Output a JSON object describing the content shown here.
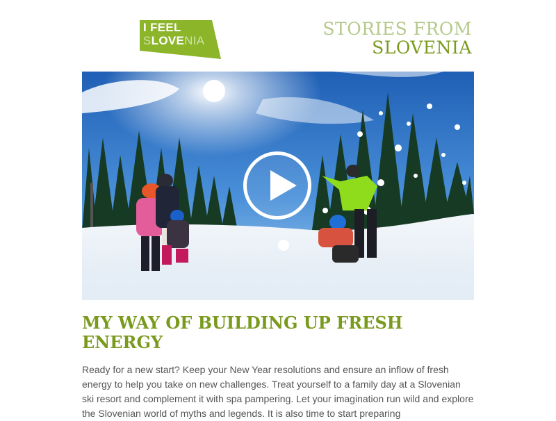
{
  "logo": {
    "line1": "I FEEL",
    "line2_a": "S",
    "line2_b": "L",
    "line2_c": "OVE",
    "line2_d": "NIA",
    "color": "#8cb52a"
  },
  "stories": {
    "line1": "STORIES FROM",
    "line2": "SLOVENIA"
  },
  "hero": {
    "play_icon": "play-icon",
    "description": "video thumbnail"
  },
  "article": {
    "title": "MY WAY OF BUILDING UP FRESH ENERGY",
    "body": "Ready for a new start? Keep your New Year resolutions and ensure an inflow of fresh energy to help you take on new challenges. Treat yourself to a family day at a Slovenian ski resort and complement it with spa pampering. Let your imagination run wild and explore the Slovenian world of myths and legends. It is also time to start preparing"
  },
  "colors": {
    "accent": "#7a9a1e",
    "accent_light": "#b5c98a",
    "text": "#555555"
  }
}
